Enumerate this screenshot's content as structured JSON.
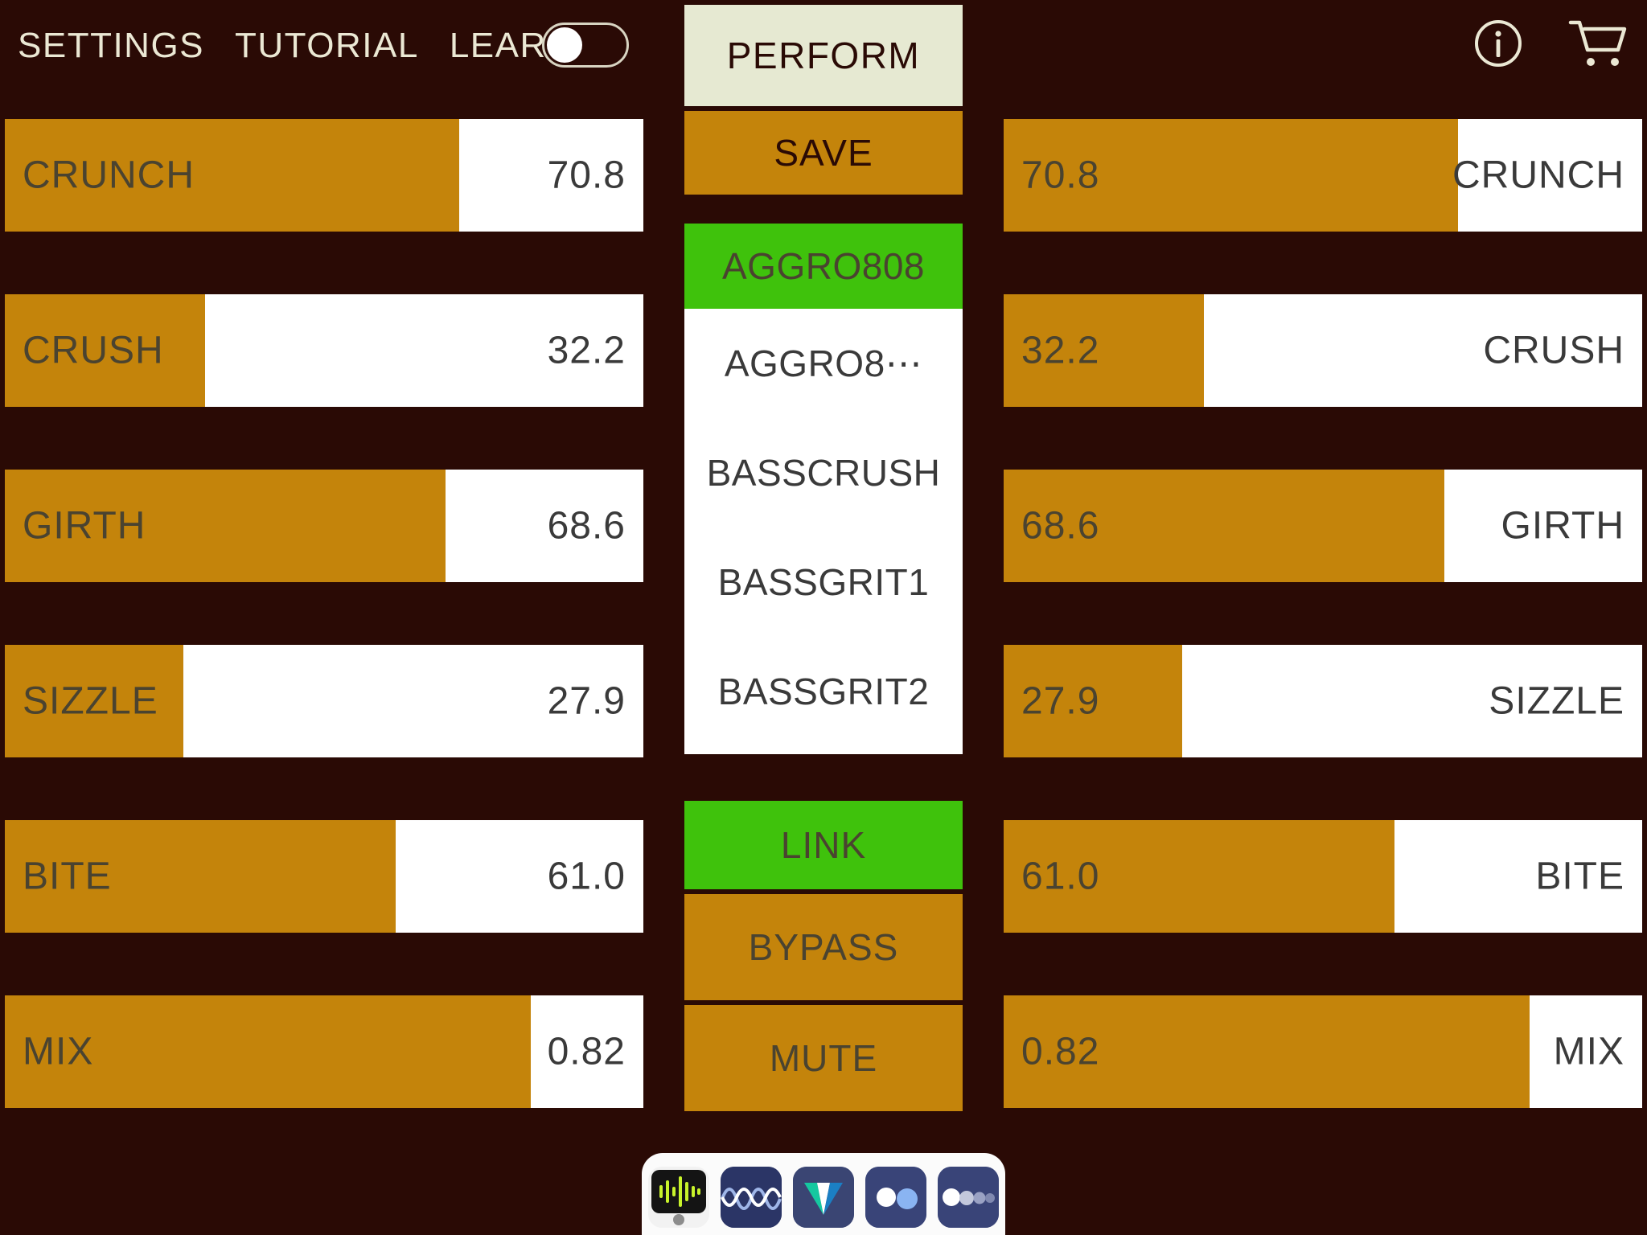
{
  "app": {
    "background_color": "#2a0a05",
    "fill_color": "#c4840b",
    "accent_green": "#3fc20c",
    "panel_white": "#ffffff",
    "perform_color": "#e6e9d2"
  },
  "header": {
    "menu": [
      {
        "label": "SETTINGS",
        "name": "settings"
      },
      {
        "label": "TUTORIAL",
        "name": "tutorial"
      },
      {
        "label": "LEARN",
        "name": "learn"
      }
    ],
    "learn_toggle": {
      "state": "off"
    },
    "perform_label": "PERFORM",
    "icons": [
      {
        "name": "info-icon",
        "glyph": "i"
      },
      {
        "name": "cart-icon",
        "glyph": "cart"
      }
    ]
  },
  "sliders": [
    {
      "label": "CRUNCH",
      "value": "70.8",
      "fill_pct": 71.2
    },
    {
      "label": "CRUSH",
      "value": "32.2",
      "fill_pct": 31.4
    },
    {
      "label": "GIRTH",
      "value": "68.6",
      "fill_pct": 69.0
    },
    {
      "label": "SIZZLE",
      "value": "27.9",
      "fill_pct": 28.0
    },
    {
      "label": "BITE",
      "value": "61.0",
      "fill_pct": 61.2
    },
    {
      "label": "MIX",
      "value": "0.82",
      "fill_pct": 82.4
    }
  ],
  "center": {
    "save_label": "SAVE",
    "preset_current": "AGGRO808",
    "preset_list": [
      "AGGRO8⋯",
      "BASSCRUSH",
      "BASSGRIT1",
      "BASSGRIT2"
    ],
    "link_label": "LINK",
    "bypass_label": "BYPASS",
    "mute_label": "MUTE"
  },
  "dock": {
    "items": [
      {
        "name": "dock-voice-memos-icon"
      },
      {
        "name": "dock-waveform-icon"
      },
      {
        "name": "dock-chevron-app-icon"
      },
      {
        "name": "dock-two-dots-icon"
      },
      {
        "name": "dock-four-dots-icon"
      }
    ]
  }
}
